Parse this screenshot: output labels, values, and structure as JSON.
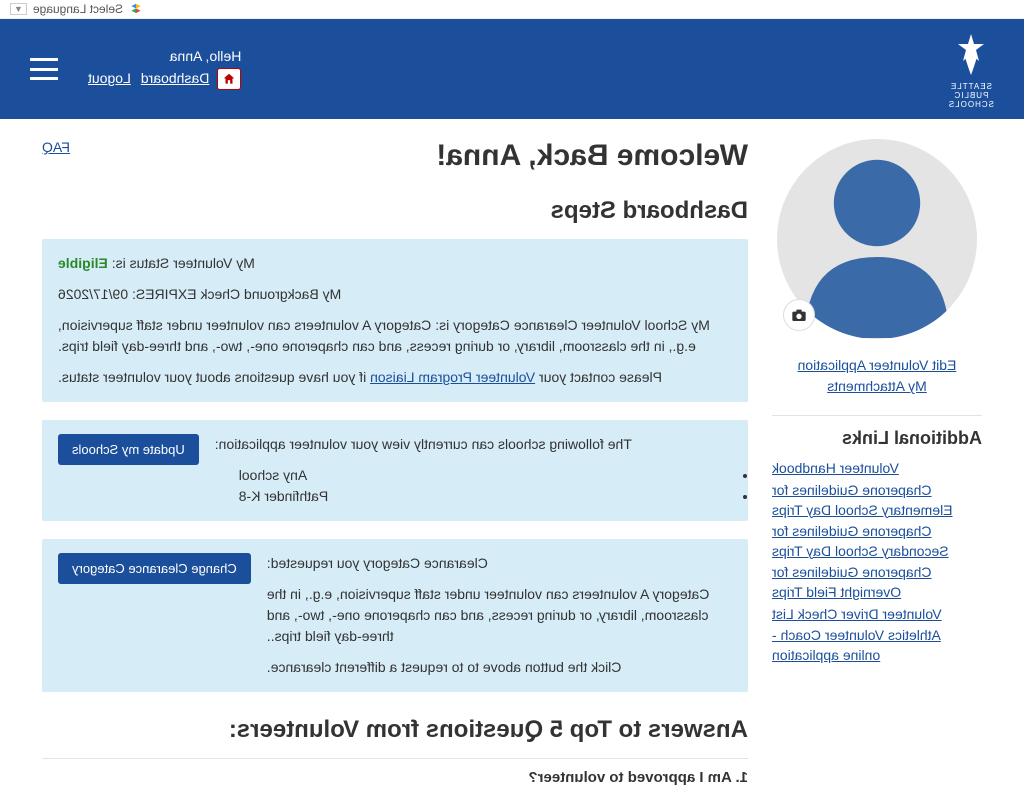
{
  "topbar": {
    "select_language": "Select Language",
    "arrow": "▼"
  },
  "header": {
    "logo_lines": [
      "SEATTLE",
      "PUBLIC",
      "SCHOOLS"
    ],
    "hello": "Hello, Anna",
    "dashboard": "Dashboard",
    "logout": "Logout"
  },
  "main": {
    "welcome": "Welcome Back, Anna!",
    "faq": "FAQ",
    "dashboard_steps": "Dashboard Steps",
    "status_prefix": "My Volunteer Status is: ",
    "status_value": "Eligible",
    "bgcheck": "My Background Check EXPIRES: 09/17/2026",
    "clearance_cat": "My School Volunteer Clearance Category is: Category A volunteers can volunteer under staff supervision, e.g., in the classroom, library, or during recess, and can chaperone one-, two-, and three-day field trips.",
    "contact_prefix": "Please contact your ",
    "contact_link": "Volunteer Program Liaison",
    "contact_suffix": " if you have questions about your volunteer status.",
    "schools_intro": "The following schools can currently view your volunteer application:",
    "schools": [
      "Any school",
      "Pathfinder K-8"
    ],
    "update_schools_btn": "Update my Schools",
    "cc_requested": "Clearance Category you requested:",
    "cc_desc": "Category A volunteers can volunteer under staff supervision, e.g., in the classroom, library, or during recess, and can chaperone one-, two-, and three-day field trips..",
    "cc_hint": "Click the button above to to request a different clearance.",
    "change_cc_btn": "Change Clearance Category",
    "qa_title": "Answers to Top 5 Questions from Volunteers:",
    "qa_1": "1. Am I approved to volunteer?"
  },
  "sidebar": {
    "edit_app": "Edit Volunteer Application",
    "my_attachments": "My Attachments",
    "additional_links_title": "Additional Links",
    "links": [
      "Volunteer Handbook",
      "Chaperone Guidelines for Elementary School Day Trips",
      "Chaperone Guidelines for Secondary School Day Trips",
      "Chaperone Guidelines for Overnight Field Trips",
      "Volunteer Driver Check List",
      "Athletics Volunteer Coach - online application"
    ]
  }
}
